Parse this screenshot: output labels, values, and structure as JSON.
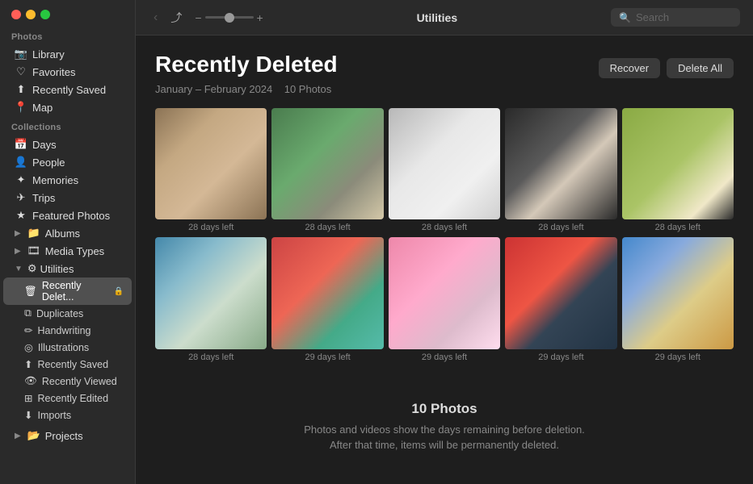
{
  "window": {
    "title": "Utilities"
  },
  "traffic_lights": {
    "red": "close",
    "yellow": "minimize",
    "green": "maximize"
  },
  "sidebar": {
    "photos_section_label": "Photos",
    "collections_section_label": "Collections",
    "photos_items": [
      {
        "id": "library",
        "label": "Library",
        "icon": "📷"
      },
      {
        "id": "favorites",
        "label": "Favorites",
        "icon": "♡"
      },
      {
        "id": "recently-saved",
        "label": "Recently Saved",
        "icon": "⬆"
      },
      {
        "id": "map",
        "label": "Map",
        "icon": "📍"
      }
    ],
    "collections_items": [
      {
        "id": "days",
        "label": "Days",
        "icon": "📅"
      },
      {
        "id": "people",
        "label": "People",
        "icon": "👤"
      },
      {
        "id": "memories",
        "label": "Memories",
        "icon": "✦"
      },
      {
        "id": "trips",
        "label": "Trips",
        "icon": "✈"
      },
      {
        "id": "featured-photos",
        "label": "Featured Photos",
        "icon": "★"
      },
      {
        "id": "albums",
        "label": "Albums",
        "icon": "📁",
        "has_chevron": true
      },
      {
        "id": "media-types",
        "label": "Media Types",
        "icon": "🎞",
        "has_chevron": true
      },
      {
        "id": "utilities",
        "label": "Utilities",
        "icon": "⚙",
        "expanded": true
      }
    ],
    "utilities_sub_items": [
      {
        "id": "recently-deleted",
        "label": "Recently Delet...",
        "icon": "🗑",
        "active": true
      },
      {
        "id": "duplicates",
        "label": "Duplicates",
        "icon": "⧉"
      },
      {
        "id": "handwriting",
        "label": "Handwriting",
        "icon": "✏"
      },
      {
        "id": "illustrations",
        "label": "Illustrations",
        "icon": "◎"
      },
      {
        "id": "recently-saved-util",
        "label": "Recently Saved",
        "icon": "⬆"
      },
      {
        "id": "recently-viewed",
        "label": "Recently Viewed",
        "icon": "👁"
      },
      {
        "id": "recently-edited",
        "label": "Recently Edited",
        "icon": "⊞"
      },
      {
        "id": "imports",
        "label": "Imports",
        "icon": "⬇"
      }
    ],
    "projects_item": {
      "id": "projects",
      "label": "Projects",
      "icon": "📂",
      "has_chevron": true
    }
  },
  "toolbar": {
    "back_label": "‹",
    "forward_label": "",
    "zoom_minus": "−",
    "zoom_plus": "+",
    "title": "Utilities",
    "search_placeholder": "Search"
  },
  "content": {
    "title": "Recently Deleted",
    "subtitle_date": "January – February 2024",
    "subtitle_count": "10 Photos",
    "recover_btn": "Recover",
    "delete_all_btn": "Delete All",
    "footer_count": "10 Photos",
    "footer_line1": "Photos and videos show the days remaining before deletion.",
    "footer_line2": "After that time, items will be permanently deleted."
  },
  "photos": [
    {
      "id": 1,
      "style_class": "photo-dog1",
      "days_label": "28 days left"
    },
    {
      "id": 2,
      "style_class": "photo-dog2",
      "days_label": "28 days left"
    },
    {
      "id": 3,
      "style_class": "photo-dog3",
      "days_label": "28 days left"
    },
    {
      "id": 4,
      "style_class": "photo-person1",
      "days_label": "28 days left"
    },
    {
      "id": 5,
      "style_class": "photo-person2",
      "days_label": "28 days left"
    },
    {
      "id": 6,
      "style_class": "photo-house",
      "days_label": "28 days left"
    },
    {
      "id": 7,
      "style_class": "photo-bowl-red",
      "days_label": "29 days left"
    },
    {
      "id": 8,
      "style_class": "photo-cake",
      "days_label": "29 days left"
    },
    {
      "id": 9,
      "style_class": "photo-bowl-orange",
      "days_label": "29 days left"
    },
    {
      "id": 10,
      "style_class": "photo-beach",
      "days_label": "29 days left"
    }
  ]
}
